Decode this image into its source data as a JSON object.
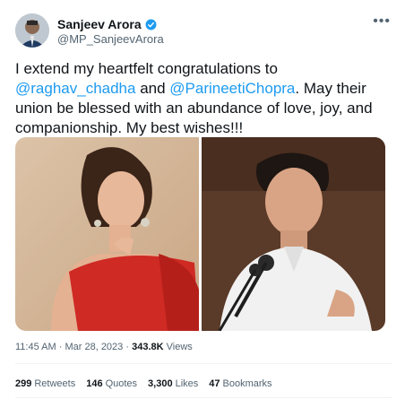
{
  "author": {
    "name": "Sanjeev Arora",
    "handle": "@MP_SanjeevArora",
    "verified": true,
    "avatar_icon": "person-avatar-icon"
  },
  "more_icon": "ellipsis-icon",
  "tweet": {
    "parts": {
      "p1": "I extend my heartfelt congratulations to ",
      "m1": "@raghav_chadha",
      "p2": " and ",
      "m2": "@ParineetiChopra",
      "p3": ". May their union be blessed with an abundance of love, joy, and companionship. My best wishes!!!"
    }
  },
  "meta": {
    "time": "11:45 AM",
    "sep": "·",
    "date": "Mar 28, 2023",
    "views_count": "343.8K",
    "views_label": "Views"
  },
  "stats": {
    "retweets": {
      "count": "299",
      "label": "Retweets"
    },
    "quotes": {
      "count": "146",
      "label": "Quotes"
    },
    "likes": {
      "count": "3,300",
      "label": "Likes"
    },
    "bookmarks": {
      "count": "47",
      "label": "Bookmarks"
    }
  },
  "colors": {
    "link": "#1d9bf0",
    "secondary_text": "#536471",
    "verified_badge": "#1d9bf0"
  }
}
